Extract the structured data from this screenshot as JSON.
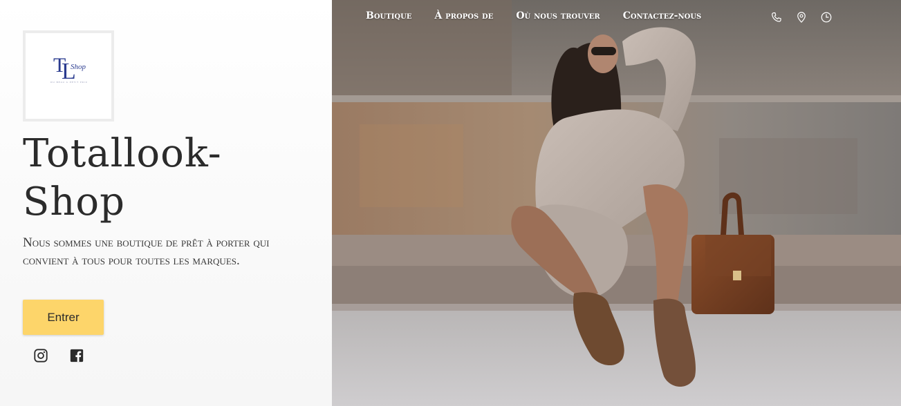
{
  "brand": {
    "logo_text": "TL",
    "logo_script": "Shop",
    "logo_tagline": "DU BEAU À PETIT PRIX",
    "title": "Totallook-Shop",
    "description": "Nous sommes une boutique de prêt à porter qui convient à tous pour toutes les marques.",
    "enter_label": "Entrer"
  },
  "social": [
    {
      "icon": "instagram-icon"
    },
    {
      "icon": "facebook-icon"
    }
  ],
  "nav": {
    "items": [
      {
        "label": "Boutique"
      },
      {
        "label": "À propos de"
      },
      {
        "label": "Où nous trouver"
      },
      {
        "label": "Contactez-nous"
      }
    ],
    "icons": [
      "phone-icon",
      "location-pin-icon",
      "clock-icon"
    ]
  },
  "colors": {
    "accent_button": "#fdd56a",
    "title_text": "#2b2b2b",
    "logo_blue": "#2a3b8f"
  }
}
